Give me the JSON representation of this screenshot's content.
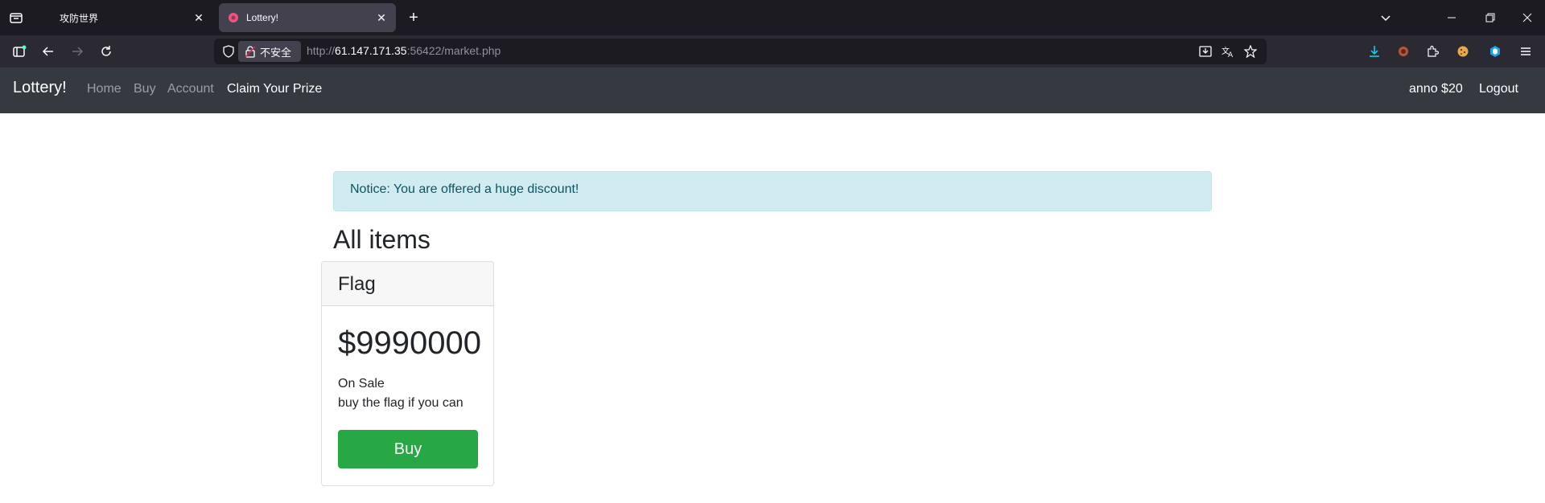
{
  "browser": {
    "tabs": [
      {
        "title": "攻防世界",
        "active": false
      },
      {
        "title": "Lottery!",
        "active": true
      }
    ],
    "url_prefix": "http://",
    "url_host": "61.147.171.35",
    "url_rest": ":56422/market.php",
    "insecure_label": "不安全"
  },
  "site": {
    "brand": "Lottery!",
    "nav": [
      "Home",
      "Buy",
      "Account",
      "Claim Your Prize"
    ],
    "user": "anno $20",
    "logout": "Logout"
  },
  "notice": "Notice: You are offered a huge discount!",
  "heading": "All items",
  "item": {
    "name": "Flag",
    "price": "$9990000",
    "status": "On Sale",
    "description": "buy the flag if you can",
    "buy_label": "Buy"
  },
  "colors": {
    "navbar": "#343a40",
    "alert_bg": "#d1ecf1",
    "buy_button": "#28a745"
  }
}
